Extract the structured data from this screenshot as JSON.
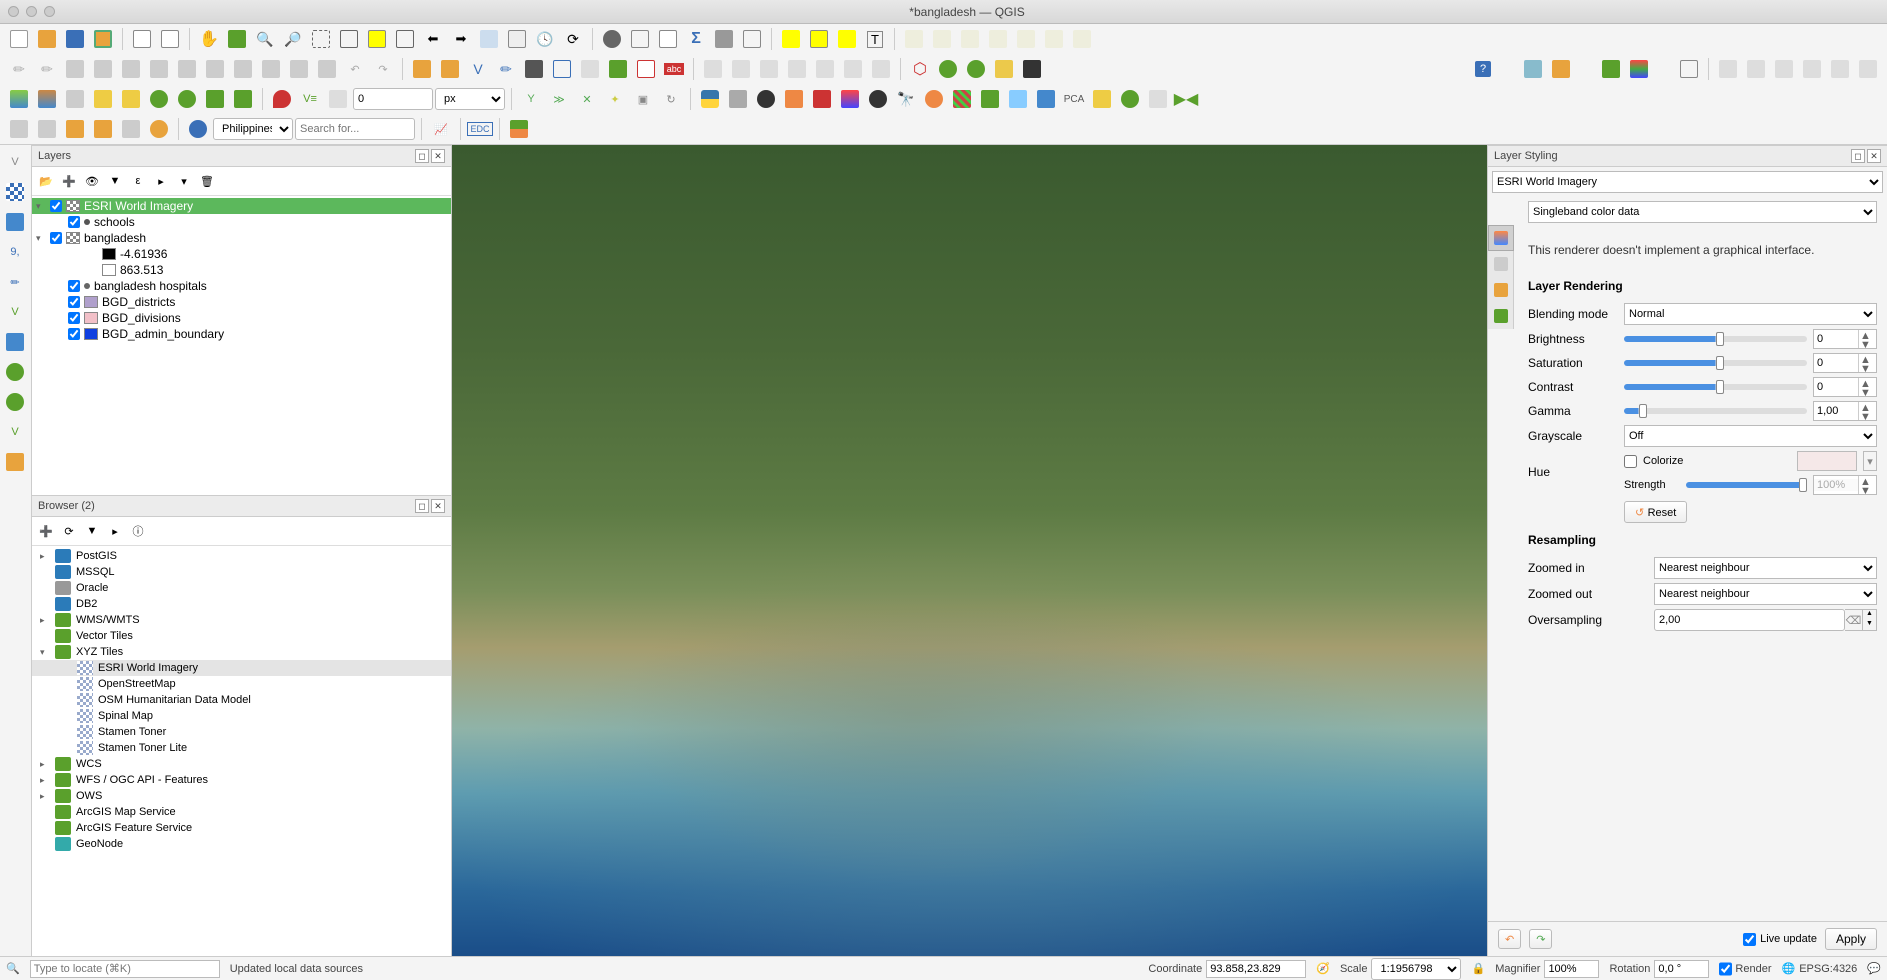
{
  "window": {
    "title": "*bangladesh — QGIS"
  },
  "toolbar2": {
    "num_value": "0",
    "unit": "px",
    "search_region": "Philippines",
    "search_placeholder": "Search for..."
  },
  "panels": {
    "layers": {
      "title": "Layers",
      "items": [
        {
          "name": "ESRI World Imagery",
          "checked": true,
          "selected": true,
          "kind": "raster",
          "exp": "▾"
        },
        {
          "name": "schools",
          "checked": true,
          "kind": "point",
          "color": "#555",
          "indent": 1
        },
        {
          "name": "bangladesh",
          "checked": true,
          "kind": "raster",
          "exp": "▾"
        },
        {
          "name": "-4.61936",
          "kind": "value",
          "color": "#000",
          "indent": 2
        },
        {
          "name": "863.513",
          "kind": "value",
          "color": "#fff",
          "indent": 2
        },
        {
          "name": "bangladesh hospitals",
          "checked": true,
          "kind": "point",
          "color": "#666",
          "indent": 1
        },
        {
          "name": "BGD_districts",
          "checked": true,
          "kind": "polygon",
          "color": "#b0a0cc",
          "indent": 1
        },
        {
          "name": "BGD_divisions",
          "checked": true,
          "kind": "polygon",
          "color": "#f2c0c8",
          "indent": 1
        },
        {
          "name": "BGD_admin_boundary",
          "checked": true,
          "kind": "polygon",
          "color": "#1040e0",
          "indent": 1
        }
      ]
    },
    "browser": {
      "title": "Browser (2)",
      "items": [
        {
          "name": "PostGIS",
          "exp": "▸",
          "color": "#2b7bb9"
        },
        {
          "name": "MSSQL",
          "color": "#2b7bb9"
        },
        {
          "name": "Oracle",
          "color": "#999"
        },
        {
          "name": "DB2",
          "color": "#2b7bb9"
        },
        {
          "name": "WMS/WMTS",
          "exp": "▸",
          "color": "#5aa02c"
        },
        {
          "name": "Vector Tiles",
          "color": "#5aa02c"
        },
        {
          "name": "XYZ Tiles",
          "exp": "▾",
          "color": "#5aa02c"
        },
        {
          "name": "ESRI World Imagery",
          "indent": 1,
          "selected": true,
          "color": "#9ac"
        },
        {
          "name": "OpenStreetMap",
          "indent": 1,
          "color": "#9ac"
        },
        {
          "name": "OSM Humanitarian Data Model",
          "indent": 1,
          "color": "#9ac"
        },
        {
          "name": "Spinal Map",
          "indent": 1,
          "color": "#9ac"
        },
        {
          "name": "Stamen Toner",
          "indent": 1,
          "color": "#9ac"
        },
        {
          "name": "Stamen Toner Lite",
          "indent": 1,
          "color": "#9ac"
        },
        {
          "name": "WCS",
          "exp": "▸",
          "color": "#5aa02c"
        },
        {
          "name": "WFS / OGC API - Features",
          "exp": "▸",
          "color": "#5aa02c"
        },
        {
          "name": "OWS",
          "exp": "▸",
          "color": "#5aa02c"
        },
        {
          "name": "ArcGIS Map Service",
          "color": "#5aa02c"
        },
        {
          "name": "ArcGIS Feature Service",
          "color": "#5aa02c"
        },
        {
          "name": "GeoNode",
          "color": "#3aa"
        }
      ]
    }
  },
  "styling": {
    "title": "Layer Styling",
    "layer": "ESRI World Imagery",
    "renderer": "Singleband color data",
    "renderer_msg": "This renderer doesn't implement a graphical interface.",
    "rendering_title": "Layer Rendering",
    "blend_label": "Blending mode",
    "blend_value": "Normal",
    "brightness_label": "Brightness",
    "brightness_value": "0",
    "saturation_label": "Saturation",
    "saturation_value": "0",
    "contrast_label": "Contrast",
    "contrast_value": "0",
    "gamma_label": "Gamma",
    "gamma_value": "1,00",
    "grayscale_label": "Grayscale",
    "grayscale_value": "Off",
    "hue_label": "Hue",
    "colorize_label": "Colorize",
    "strength_label": "Strength",
    "strength_value": "100%",
    "reset_label": "Reset",
    "resampling_title": "Resampling",
    "zoomed_in_label": "Zoomed in",
    "zoomed_in_value": "Nearest neighbour",
    "zoomed_out_label": "Zoomed out",
    "zoomed_out_value": "Nearest neighbour",
    "oversampling_label": "Oversampling",
    "oversampling_value": "2,00",
    "live_update_label": "Live update",
    "apply_label": "Apply"
  },
  "statusbar": {
    "locator_placeholder": "Type to locate (⌘K)",
    "message": "Updated local data sources",
    "coord_label": "Coordinate",
    "coord_value": "93.858,23.829",
    "scale_label": "Scale",
    "scale_value": "1:1956798",
    "magnifier_label": "Magnifier",
    "magnifier_value": "100%",
    "rotation_label": "Rotation",
    "rotation_value": "0,0 °",
    "render_label": "Render",
    "crs_label": "EPSG:4326"
  }
}
